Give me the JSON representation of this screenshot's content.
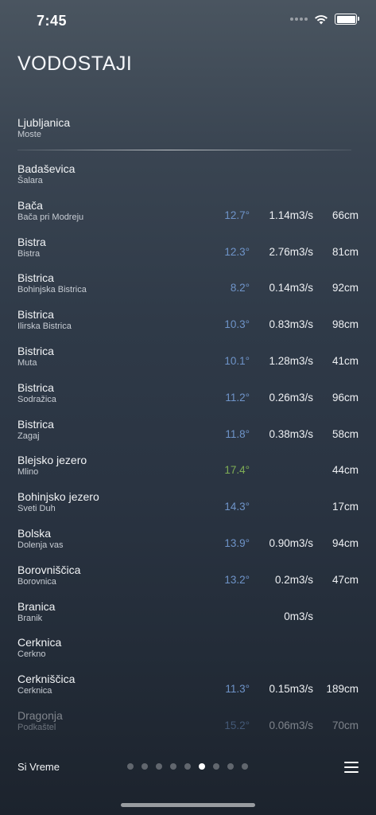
{
  "status_bar": {
    "time": "7:45",
    "icons": [
      "signal-icon",
      "wifi-icon",
      "battery-icon"
    ]
  },
  "title": "VODOSTAJI",
  "favorite": {
    "river": "Ljubljanica",
    "station": "Moste"
  },
  "rows": [
    {
      "river": "Badaševica",
      "station": "Šalara",
      "temp": "",
      "flow": "",
      "level": ""
    },
    {
      "river": "Bača",
      "station": "Bača pri Modreju",
      "temp": "12.7°",
      "flow": "1.14m3/s",
      "level": "66cm"
    },
    {
      "river": "Bistra",
      "station": "Bistra",
      "temp": "12.3°",
      "flow": "2.76m3/s",
      "level": "81cm"
    },
    {
      "river": "Bistrica",
      "station": "Bohinjska Bistrica",
      "temp": "8.2°",
      "flow": "0.14m3/s",
      "level": "92cm"
    },
    {
      "river": "Bistrica",
      "station": "Ilirska Bistrica",
      "temp": "10.3°",
      "flow": "0.83m3/s",
      "level": "98cm"
    },
    {
      "river": "Bistrica",
      "station": "Muta",
      "temp": "10.1°",
      "flow": "1.28m3/s",
      "level": "41cm"
    },
    {
      "river": "Bistrica",
      "station": "Sodražica",
      "temp": "11.2°",
      "flow": "0.26m3/s",
      "level": "96cm"
    },
    {
      "river": "Bistrica",
      "station": "Zagaj",
      "temp": "11.8°",
      "flow": "0.38m3/s",
      "level": "58cm"
    },
    {
      "river": "Blejsko jezero",
      "station": "Mlino",
      "temp": "17.4°",
      "flow": "",
      "level": "44cm"
    },
    {
      "river": "Bohinjsko jezero",
      "station": "Sveti Duh",
      "temp": "14.3°",
      "flow": "",
      "level": "17cm"
    },
    {
      "river": "Bolska",
      "station": "Dolenja vas",
      "temp": "13.9°",
      "flow": "0.90m3/s",
      "level": "94cm"
    },
    {
      "river": "Borovniščica",
      "station": "Borovnica",
      "temp": "13.2°",
      "flow": "0.2m3/s",
      "level": "47cm"
    },
    {
      "river": "Branica",
      "station": "Branik",
      "temp": "",
      "flow": "0m3/s",
      "level": ""
    },
    {
      "river": "Cerknica",
      "station": "Cerkno",
      "temp": "",
      "flow": "",
      "level": ""
    },
    {
      "river": "Cerkniščica",
      "station": "Cerknica",
      "temp": "11.3°",
      "flow": "0.15m3/s",
      "level": "189cm"
    },
    {
      "river": "Dragonja",
      "station": "Podkaštel",
      "temp": "15.2°",
      "flow": "0.06m3/s",
      "level": "70cm"
    }
  ],
  "footer": {
    "brand": "Si Vreme",
    "page_count": 9,
    "active_page": 6,
    "menu_icon": "hamburger-menu-icon"
  },
  "colors": {
    "temp_cool": "#6f94c9",
    "temp_warm": "#7fae55"
  }
}
